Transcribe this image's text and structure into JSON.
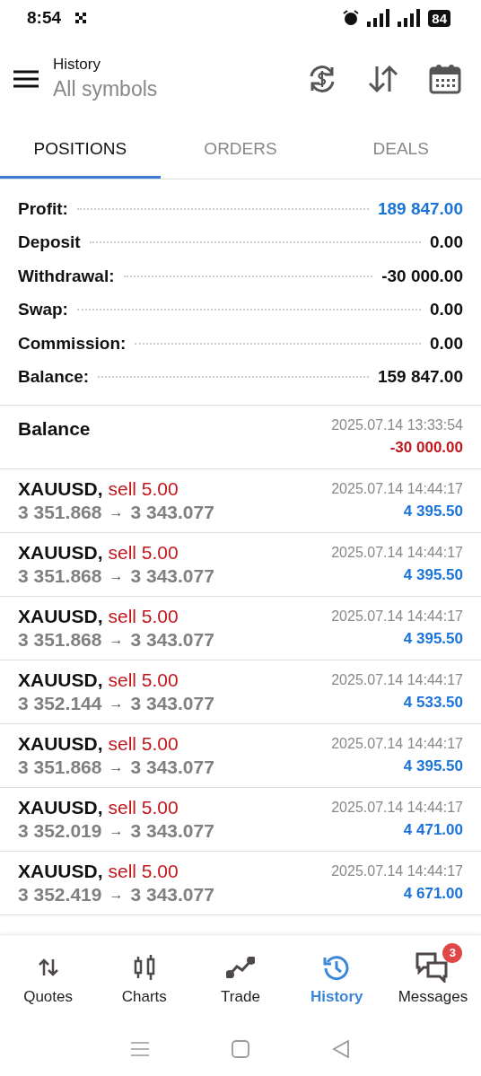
{
  "status_bar": {
    "time": "8:54",
    "battery": "84"
  },
  "header": {
    "title": "History",
    "subtitle": "All symbols"
  },
  "tabs": [
    {
      "label": "POSITIONS",
      "selected": true
    },
    {
      "label": "ORDERS",
      "selected": false
    },
    {
      "label": "DEALS",
      "selected": false
    }
  ],
  "summary": [
    {
      "label": "Profit:",
      "value": "189 847.00",
      "color": "#1a73d9"
    },
    {
      "label": "Deposit",
      "value": "0.00",
      "color": "#111111"
    },
    {
      "label": "Withdrawal:",
      "value": "-30 000.00",
      "color": "#111111"
    },
    {
      "label": "Swap:",
      "value": "0.00",
      "color": "#111111"
    },
    {
      "label": "Commission:",
      "value": "0.00",
      "color": "#111111"
    },
    {
      "label": "Balance:",
      "value": "159 847.00",
      "color": "#111111"
    }
  ],
  "entries": [
    {
      "kind": "balance",
      "title": "Balance",
      "time": "2025.07.14 13:33:54",
      "profit": "-30 000.00",
      "color": "#c0161c"
    },
    {
      "kind": "deal",
      "symbol": "XAUUSD,",
      "action": "sell 5.00",
      "open": "3 351.868",
      "arrow": "→",
      "close": "3 343.077",
      "time": "2025.07.14 14:44:17",
      "profit": "4 395.50",
      "color": "#1a73d9"
    },
    {
      "kind": "deal",
      "symbol": "XAUUSD,",
      "action": "sell 5.00",
      "open": "3 351.868",
      "arrow": "→",
      "close": "3 343.077",
      "time": "2025.07.14 14:44:17",
      "profit": "4 395.50",
      "color": "#1a73d9"
    },
    {
      "kind": "deal",
      "symbol": "XAUUSD,",
      "action": "sell 5.00",
      "open": "3 351.868",
      "arrow": "→",
      "close": "3 343.077",
      "time": "2025.07.14 14:44:17",
      "profit": "4 395.50",
      "color": "#1a73d9"
    },
    {
      "kind": "deal",
      "symbol": "XAUUSD,",
      "action": "sell 5.00",
      "open": "3 352.144",
      "arrow": "→",
      "close": "3 343.077",
      "time": "2025.07.14 14:44:17",
      "profit": "4 533.50",
      "color": "#1a73d9"
    },
    {
      "kind": "deal",
      "symbol": "XAUUSD,",
      "action": "sell 5.00",
      "open": "3 351.868",
      "arrow": "→",
      "close": "3 343.077",
      "time": "2025.07.14 14:44:17",
      "profit": "4 395.50",
      "color": "#1a73d9"
    },
    {
      "kind": "deal",
      "symbol": "XAUUSD,",
      "action": "sell 5.00",
      "open": "3 352.019",
      "arrow": "→",
      "close": "3 343.077",
      "time": "2025.07.14 14:44:17",
      "profit": "4 471.00",
      "color": "#1a73d9"
    },
    {
      "kind": "deal",
      "symbol": "XAUUSD,",
      "action": "sell 5.00",
      "open": "3 352.419",
      "arrow": "→",
      "close": "3 343.077",
      "time": "2025.07.14 14:44:17",
      "profit": "4 671.00",
      "color": "#1a73d9"
    }
  ],
  "bottom_nav": [
    {
      "kind": "quotes",
      "label": "Quotes",
      "selected": false
    },
    {
      "kind": "charts",
      "label": "Charts",
      "selected": false
    },
    {
      "kind": "trade",
      "label": "Trade",
      "selected": false
    },
    {
      "kind": "history",
      "label": "History",
      "selected": true
    },
    {
      "kind": "messages",
      "label": "Messages",
      "selected": false,
      "badge": "3"
    }
  ]
}
